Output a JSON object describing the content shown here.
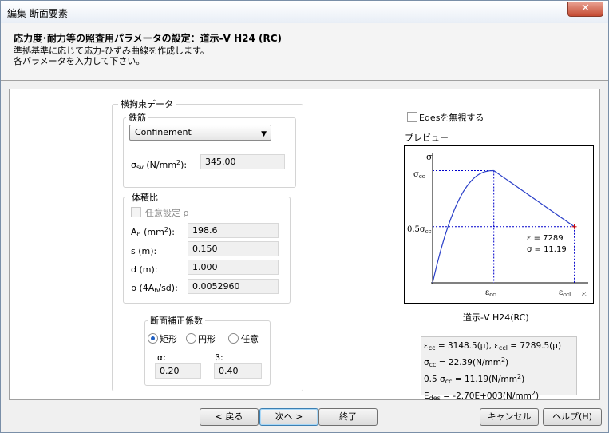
{
  "window": {
    "title": "編集 断面要素",
    "close_label": "✕"
  },
  "header": {
    "title": "応力度･耐力等の照査用パラメータの設定：道示-V H24 (RC)",
    "line1": "準拠基準に応じて応力-ひずみ曲線を作成します。",
    "line2": "各パラメータを入力して下さい。"
  },
  "confinement": {
    "legend": "横拘束データ",
    "rebar": {
      "legend": "鉄筋",
      "select_value": "Confinement",
      "sigma_label": "σsv (N/mm2):",
      "sigma_value": "345.00"
    },
    "volume": {
      "legend": "体積比",
      "checkbox_label": "任意設定 ρ",
      "ah_label": "Ah (mm2):",
      "ah_value": "198.6",
      "s_label": "s (m):",
      "s_value": "0.150",
      "d_label": "d (m):",
      "d_value": "1.000",
      "rho_label": "ρ (4Ah/sd):",
      "rho_value": "0.0052960"
    }
  },
  "correction": {
    "legend": "断面補正係数",
    "options": [
      "矩形",
      "円形",
      "任意"
    ],
    "alpha_label": "α:",
    "alpha_value": "0.20",
    "beta_label": "β:",
    "beta_value": "0.40"
  },
  "edes_checkbox_label": "Edesを無視する",
  "preview": {
    "label": "プレビュー",
    "y_axis": "σ",
    "x_axis": "ε",
    "y_tick_top": "σcc",
    "y_tick_mid": "0.5σcc",
    "x_tick_1": "εcc",
    "x_tick_2": "εccl",
    "point_eps": "ε = 7289",
    "point_sigma": "σ = 11.19",
    "caption": "道示-V H24(RC)"
  },
  "info": {
    "line1": "εcc = 3148.5(μ), εccl = 7289.5(μ)",
    "line2": "σcc = 22.39(N/mm2)",
    "line3": "0.5 σcc = 11.19(N/mm2)",
    "line4": "Edes = -2.70E+003(N/mm2)"
  },
  "buttons": {
    "back": "< 戻る",
    "next": "次へ >",
    "finish": "終了",
    "cancel": "キャンセル",
    "help": "ヘルプ(H)"
  },
  "chart_data": {
    "type": "line",
    "series": [
      {
        "values": [
          {
            "x": 0,
            "y": 0
          },
          {
            "x": 3148.5,
            "y": 22.39
          },
          {
            "x": 7289.5,
            "y": 11.19
          }
        ]
      }
    ],
    "xlabel": "ε",
    "ylabel": "σ"
  }
}
